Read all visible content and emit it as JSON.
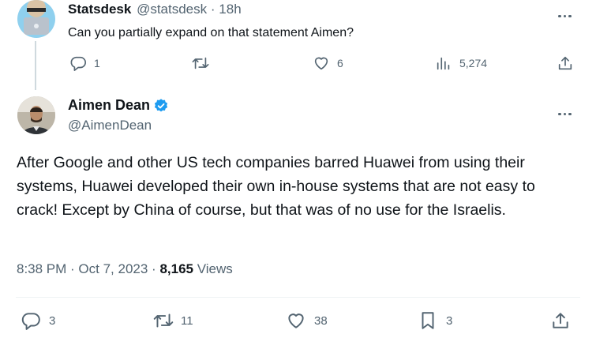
{
  "reply": {
    "display_name": "Statsdesk",
    "handle": "@statsdesk",
    "separator": "·",
    "time": "18h",
    "text": "Can you partially expand on that statement Aimen?",
    "actions": {
      "replies": "1",
      "retweets": "",
      "likes": "6",
      "views": "5,274"
    }
  },
  "main_tweet": {
    "display_name": "Aimen Dean",
    "handle": "@AimenDean",
    "text": "After Google and other US tech companies barred Huawei from using their systems, Huawei developed their own in-house systems that are not easy to crack! Except by China of course, but that was of no use for the Israelis.",
    "timestamp": "8:38 PM · Oct 7, 2023 ·",
    "views_count": "8,165",
    "views_label": "Views",
    "actions": {
      "replies": "3",
      "retweets": "11",
      "likes": "38",
      "bookmarks": "3"
    }
  },
  "colors": {
    "text": "#0f1419",
    "muted": "#536471",
    "verified": "#1d9bf0",
    "divider": "#eff3f4"
  },
  "icons": [
    "more-icon",
    "reply-icon",
    "retweet-icon",
    "like-icon",
    "views-icon",
    "share-icon",
    "bookmark-icon",
    "verified-badge-icon"
  ]
}
